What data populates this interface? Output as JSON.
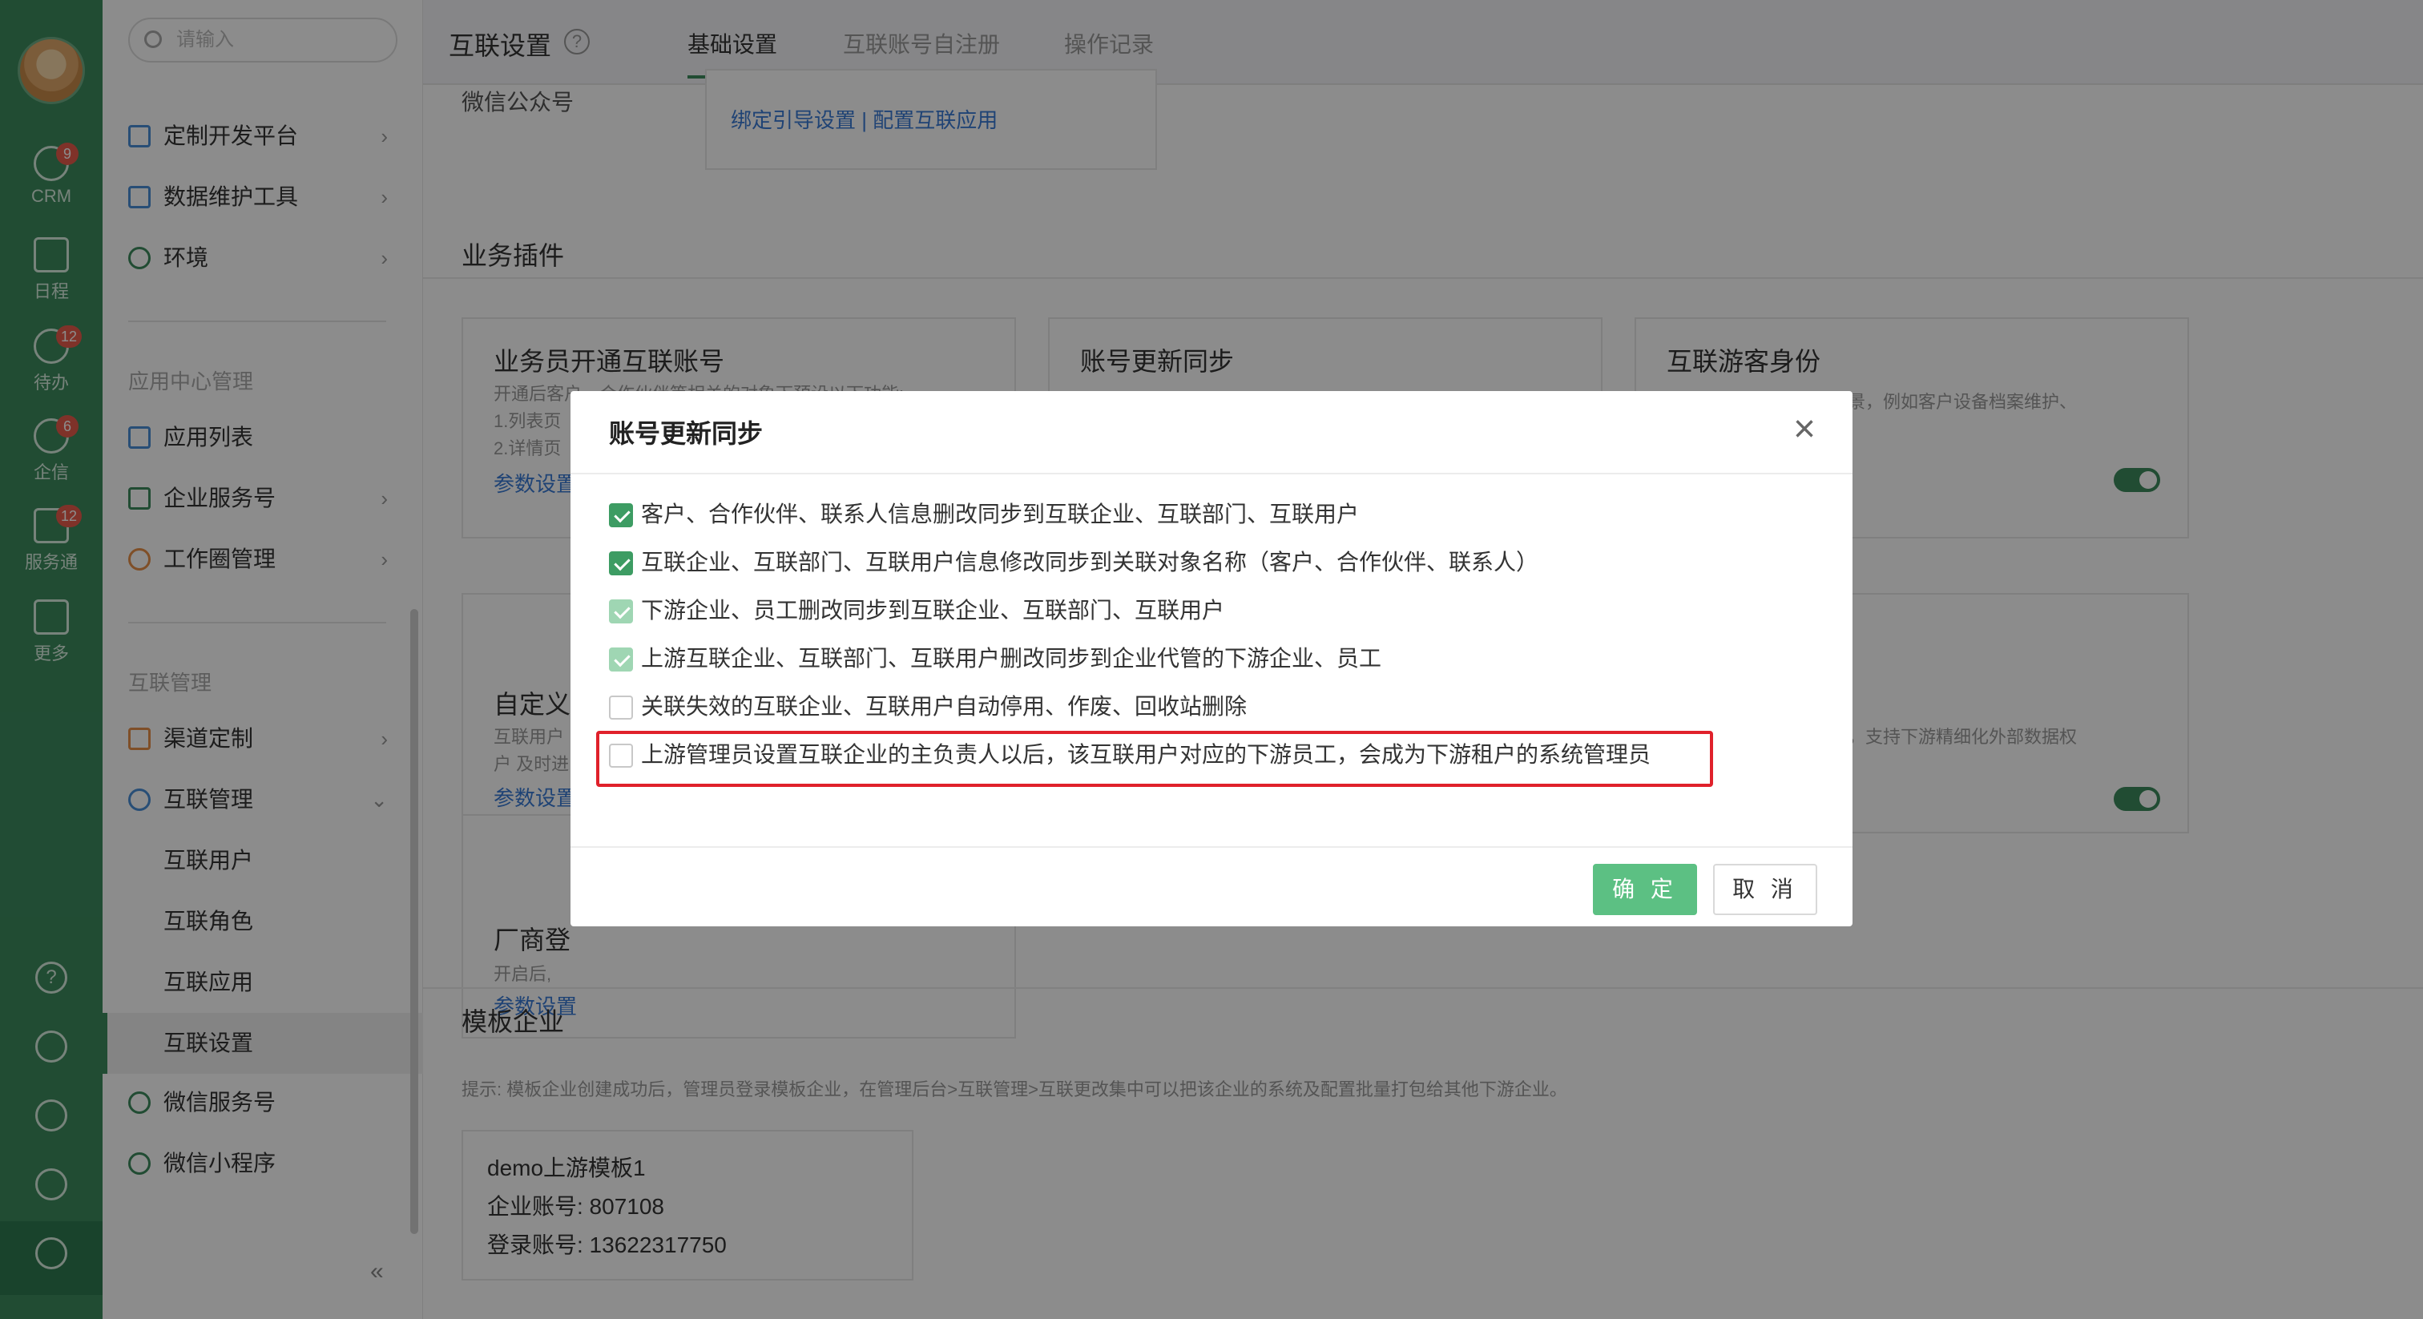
{
  "rail": {
    "items": [
      {
        "label": "CRM",
        "badge": "9"
      },
      {
        "label": "日程",
        "badge": ""
      },
      {
        "label": "待办",
        "badge": "12"
      },
      {
        "label": "企信",
        "badge": "6"
      },
      {
        "label": "服务通",
        "badge": "12"
      },
      {
        "label": "更多",
        "badge": ""
      }
    ]
  },
  "sidebar": {
    "search_placeholder": "请输入",
    "top_items": [
      "定制开发平台",
      "数据维护工具",
      "环境"
    ],
    "section_app": "应用中心管理",
    "app_items": [
      "应用列表",
      "企业服务号",
      "工作圈管理"
    ],
    "section_interconnect": "互联管理",
    "inter_items": [
      "渠道定制",
      "互联管理"
    ],
    "inter_sub": [
      "互联用户",
      "互联角色",
      "互联应用",
      "互联设置"
    ],
    "bottom_items": [
      "微信服务号",
      "微信小程序"
    ]
  },
  "header": {
    "title": "互联设置",
    "tabs": [
      "基础设置",
      "互联账号自注册",
      "操作记录"
    ]
  },
  "content": {
    "wechat_label": "微信公众号",
    "wechat_links": "绑定引导设置 | 配置互联应用",
    "plugins_title": "业务插件",
    "card1_title": "业务员开通互联账号",
    "card1_desc1": "开通后客户、合作伙伴等相关的对象下预设以下功能:",
    "card1_desc2": "1.列表页",
    "card1_desc3": "2.详情页",
    "card1_link": "参数设置",
    "card2_title": "账号更新同步",
    "card3_title": "互联游客身份",
    "card3_desc": "务场景，例如客户设备档案维护、",
    "card4_title": "自定义",
    "card4_desc1": "互联用户",
    "card4_desc2": "户 及时进",
    "card4_link": "参数设置",
    "card6_desc": "对象，支持下游精细化外部数据权",
    "card7_title": "厂商登",
    "card7_desc": "开启后,",
    "card7_link": "参数设置",
    "template_title": "模板企业",
    "template_hint": "提示: 模板企业创建成功后，管理员登录模板企业，在管理后台>互联管理>互联更改集中可以把该企业的系统及配置批量打包给其他下游企业。",
    "template_name": "demo上游模板1",
    "template_account": "企业账号: 807108",
    "template_login": "登录账号: 13622317750"
  },
  "modal": {
    "title": "账号更新同步",
    "options": [
      {
        "label": "客户、合作伙伴、联系人信息删改同步到互联企业、互联部门、互联用户",
        "state": "checked"
      },
      {
        "label": "互联企业、互联部门、互联用户信息修改同步到关联对象名称（客户、合作伙伴、联系人）",
        "state": "checked"
      },
      {
        "label": "下游企业、员工删改同步到互联企业、互联部门、互联用户",
        "state": "checked-disabled"
      },
      {
        "label": "上游互联企业、互联部门、互联用户删改同步到企业代管的下游企业、员工",
        "state": "checked-disabled"
      },
      {
        "label": "关联失效的互联企业、互联用户自动停用、作废、回收站删除",
        "state": "unchecked"
      },
      {
        "label": "上游管理员设置互联企业的主负责人以后，该互联用户对应的下游员工，会成为下游租户的系统管理员",
        "state": "unchecked"
      }
    ],
    "ok_label": "确 定",
    "cancel_label": "取 消"
  },
  "colors": {
    "brand": "#3d8a5e",
    "ok_button": "#5cc083",
    "highlight": "#e0212b",
    "link": "#3a7bd5"
  }
}
